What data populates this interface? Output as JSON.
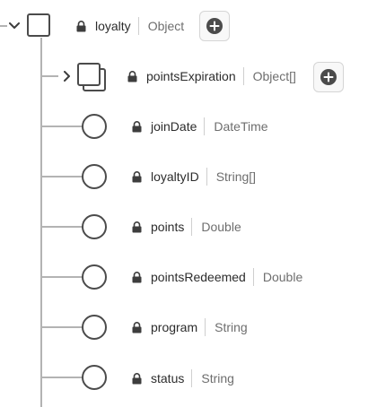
{
  "tree": {
    "root": {
      "name": "loyalty",
      "type": "Object",
      "expanded": true,
      "locked": true,
      "icon": "object-square-icon",
      "action": "add-field-icon"
    },
    "children": [
      {
        "name": "pointsExpiration",
        "type": "Object[]",
        "expanded": false,
        "locked": true,
        "icon": "object-array-icon",
        "action": "add-field-icon"
      },
      {
        "name": "joinDate",
        "type": "DateTime",
        "locked": true,
        "icon": "field-circle-icon"
      },
      {
        "name": "loyaltyID",
        "type": "String[]",
        "locked": true,
        "icon": "field-circle-icon"
      },
      {
        "name": "points",
        "type": "Double",
        "locked": true,
        "icon": "field-circle-icon"
      },
      {
        "name": "pointsRedeemed",
        "type": "Double",
        "locked": true,
        "icon": "field-circle-icon"
      },
      {
        "name": "program",
        "type": "String",
        "locked": true,
        "icon": "field-circle-icon"
      },
      {
        "name": "status",
        "type": "String",
        "locked": true,
        "icon": "field-circle-icon"
      }
    ]
  },
  "colors": {
    "tree_line": "#b3b3b3",
    "icon_stroke": "#4b4b4b",
    "text": "#2c2c2c",
    "type_text": "#6e6e6e",
    "add_button_bg": "#f8f8f8"
  }
}
